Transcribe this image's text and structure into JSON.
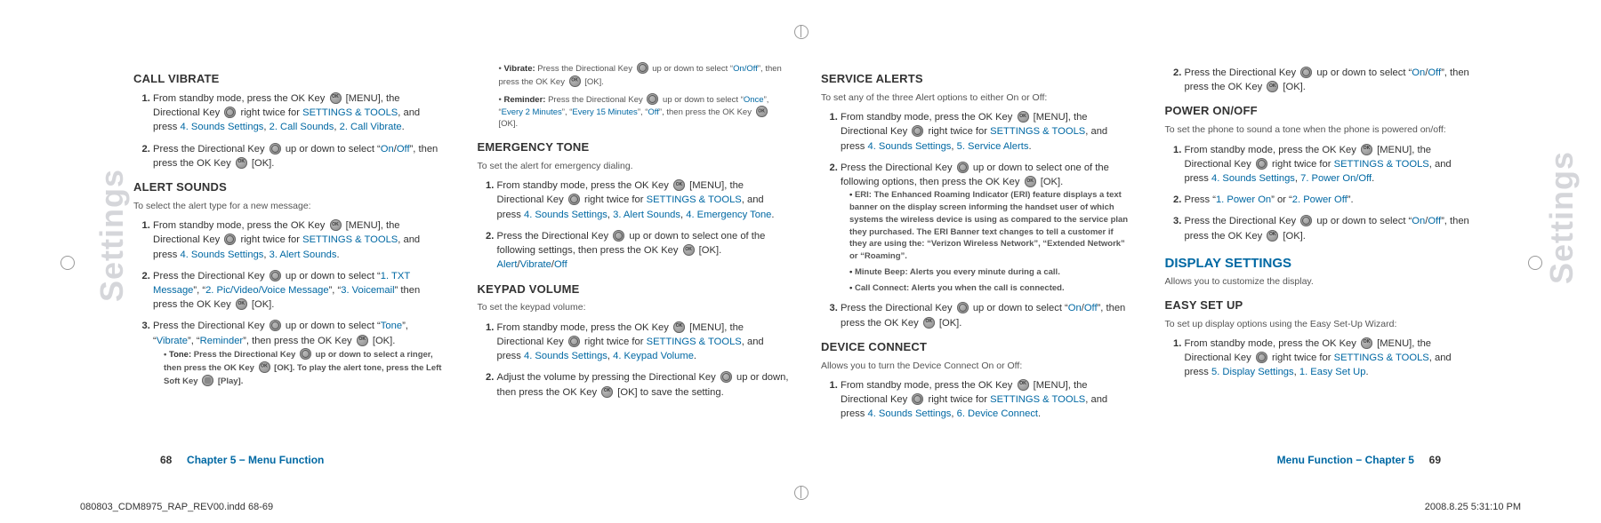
{
  "sideLabel": "Settings",
  "cols": {
    "c1": {
      "h1": "CALL VIBRATE",
      "s1a": "From standby mode, press the OK Key ",
      "s1b": " [MENU], the Directional Key ",
      "s1c": " right twice for ",
      "s1link1": "SETTINGS & TOOLS",
      "s1d": ", and press ",
      "s1link2": "4. Sounds Settings",
      "s1e": ", ",
      "s1link3": "2. Call Sounds",
      "s1f": ", ",
      "s1link4": "2. Call Vibrate",
      "s1g": ".",
      "s2a": "Press the Directional Key ",
      "s2b": " up or down to select “",
      "s2on": "On",
      "s2slash": "/",
      "s2off": "Off",
      "s2c": "”, then press the OK Key ",
      "s2d": " [OK].",
      "h2": "ALERT SOUNDS",
      "sub2": "To select the alert type for a new message:",
      "a1a": "From standby mode, press the OK Key ",
      "a1b": " [MENU], the Directional Key ",
      "a1c": " right twice for ",
      "a1d": ", and press ",
      "a1link2": "4. Sounds Settings",
      "a1e": ", ",
      "a1link3": "3. Alert Sounds",
      "a1f": ".",
      "a2a": "Press the Directional Key ",
      "a2b": " up or down to select “",
      "a2l1": "1. TXT Message",
      "a2c": "”, “",
      "a2l2": "2. Pic/Video/Voice Message",
      "a2d": "”, “",
      "a2l3": "3. Voicemail",
      "a2e": "” then press the OK Key ",
      "a2f": " [OK].",
      "a3a": "Press the Directional Key ",
      "a3b": " up or down to select “",
      "a3l1": "Tone",
      "a3c": "”, “",
      "a3l2": "Vibrate",
      "a3d": "”, “",
      "a3l3": "Reminder",
      "a3e": "”, then press the OK Key ",
      "a3f": " [OK].",
      "toneNote_b": "Tone:",
      "toneNote_t1": "  Press the Directional Key ",
      "toneNote_t2": " up or down to select a ringer, then press the OK Key ",
      "toneNote_t3": " [OK]. To play the alert tone, press the Left Soft Key ",
      "toneNote_t4": " [Play]."
    },
    "c2": {
      "vibNote_b": "Vibrate:",
      "vibNote_t1": "  Press the Directional Key ",
      "vibNote_t2": " up or down to select “",
      "vibNote_on": "On/Off",
      "vibNote_t3": "”, then press the OK Key ",
      "vibNote_t4": " [OK].",
      "remNote_b": "Reminder:",
      "remNote_t1": "  Press the Directional Key ",
      "remNote_t2": " up or down to select “",
      "remNote_o1": "Once",
      "remNote_c": "”, “",
      "remNote_o2": "Every 2 Minutes",
      "remNote_o3": "Every 15 Minutes",
      "remNote_o4": "Off",
      "remNote_t3": "”, then press the OK Key ",
      "remNote_t4": " [OK].",
      "h1": "EMERGENCY TONE",
      "sub1": "To set the alert for emergency dialing.",
      "e1a": "From standby mode, press the OK Key ",
      "e1b": " [MENU], the Directional Key ",
      "e1c": " right twice for ",
      "e1d": ", and press ",
      "e1l2": "4. Sounds Settings",
      "e1e": ", ",
      "e1l3": "3. Alert Sounds",
      "e1f": ", ",
      "e1l4": "4. Emergency Tone",
      "e1g": ".",
      "e2a": "Press the Directional Key ",
      "e2b": " up or down to select one of the following settings, then press the OK Key ",
      "e2c": " [OK].",
      "e2opts_a": "Alert",
      "e2opts_s": "/",
      "e2opts_b": "Vibrate",
      "e2opts_c": "Off",
      "h2": "KEYPAD VOLUME",
      "sub2": "To set the keypad volume:",
      "k1a": "From standby mode, press the OK Key ",
      "k1b": " [MENU], the Directional Key ",
      "k1c": " right twice for ",
      "k1d": ", and press ",
      "k1l2": "4. Sounds Settings",
      "k1e": ", ",
      "k1l3": "4. Keypad Volume",
      "k1f": ".",
      "k2a": "Adjust the volume by pressing the Directional Key ",
      "k2b": " up or down, then press the OK Key ",
      "k2c": " [OK] to save the setting."
    },
    "c3": {
      "h1": "SERVICE ALERTS",
      "sub1": "To set any of the three Alert options to either On or Off:",
      "s1a": "From standby mode, press the OK Key ",
      "s1b": " [MENU], the Directional Key ",
      "s1c": " right twice for ",
      "s1d": ", and press ",
      "s1l2": "4. Sounds Settings",
      "s1e": ", ",
      "s1l3": "5. Service Alerts",
      "s1f": ".",
      "s2a": "Press the Directional Key ",
      "s2b": " up or down to select one of the following options, then press the OK Key ",
      "s2c": " [OK].",
      "eri_b": "ERI:",
      "eri_t": "  The Enhanced Roaming Indicator (ERI) feature displays a text banner on the display screen informing the handset user of which systems the wireless device is using as compared to the service plan they purchased. The ERI Banner text changes to tell a customer if they are using the: “Verizon Wireless Network”, “Extended Network” or “Roaming”.",
      "mb_b": "Minute Beep:",
      "mb_t": "  Alerts you every minute during a call.",
      "cc_b": "Call Connect:",
      "cc_t": "  Alerts you when the call is connected.",
      "s3a": "Press the Directional Key ",
      "s3b": " up or down to select “",
      "s3on": "On",
      "s3slash": "/",
      "s3off": "Off",
      "s3c": "”, then press the OK Key ",
      "s3d": " [OK].",
      "h2": "DEVICE CONNECT",
      "sub2": "Allows you to turn the Device Connect On or Off:",
      "d1a": "From standby mode, press the OK Key ",
      "d1b": " [MENU], the Directional Key ",
      "d1c": " right twice for ",
      "d1d": ", and press ",
      "d1l2": "4. Sounds Settings",
      "d1e": ", ",
      "d1l3": "6. Device Connect",
      "d1f": "."
    },
    "c4": {
      "d2a": "Press the Directional Key ",
      "d2b": " up or down to select “",
      "d2on": "On",
      "d2s": "/",
      "d2off": "Off",
      "d2c": "”, then press the OK Key ",
      "d2d": " [OK].",
      "h1": "POWER ON/OFF",
      "sub1": "To set the phone to sound a tone when the phone is powered on/off:",
      "p1a": "From standby mode, press the OK Key ",
      "p1b": " [MENU], the Directional Key ",
      "p1c": " right twice for ",
      "p1d": ", and press ",
      "p1l2": "4. Sounds Settings",
      "p1e": ", ",
      "p1l3": "7. Power On/Off",
      "p1f": ".",
      "p2a": "Press “",
      "p2l1": "1. Power On",
      "p2b": "” or “",
      "p2l2": "2. Power Off",
      "p2c": "”.",
      "p3a": "Press the Directional Key ",
      "p3b": " up or down to select “",
      "p3on": "On",
      "p3s": "/",
      "p3off": "Off",
      "p3c": "”, then press the OK Key ",
      "p3d": " [OK].",
      "H2": "DISPLAY SETTINGS",
      "sub2": "Allows you to customize the display.",
      "h3": "EASY SET UP",
      "sub3": "To set up display options using the Easy Set-Up Wizard:",
      "e1a": "From standby mode, press the OK Key ",
      "e1b": " [MENU], the Directional Key ",
      "e1c": " right twice for ",
      "e1d": ", and press ",
      "e1l2": "5. Display Settings",
      "e1e": ", ",
      "e1l3": "1. Easy Set Up",
      "e1f": "."
    }
  },
  "stools": "SETTINGS & TOOLS",
  "footer": {
    "leftPg": "68",
    "leftCh": "Chapter 5 − Menu Function",
    "rightCh": "Menu Function − Chapter 5",
    "rightPg": "69"
  },
  "meta": {
    "left": "080803_CDM8975_RAP_REV00.indd   68-69",
    "right": "2008.8.25   5:31:10 PM"
  }
}
